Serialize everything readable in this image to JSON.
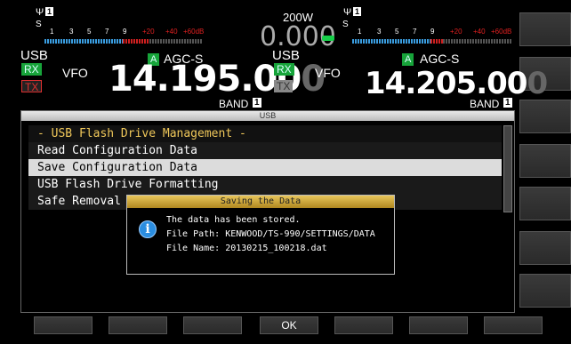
{
  "left_receiver": {
    "mode": "USB",
    "vfo": "VFO",
    "rx_label": "RX",
    "tx_label": "TX",
    "agc_badge": "A",
    "agc": "AGC-S",
    "frequency_main": "14.195.00",
    "frequency_dim": "0",
    "band_label": "BAND",
    "band_num": "1",
    "antenna_num": "1",
    "s_label": "S",
    "meter_ticks": [
      "1",
      "3",
      "5",
      "7",
      "9",
      "+20",
      "+40",
      "+60dB"
    ]
  },
  "center": {
    "power": "200W",
    "power_reading": "0.000"
  },
  "right_receiver": {
    "mode": "USB",
    "vfo": "VFO",
    "rx_label": "RX",
    "tx_label": "TX",
    "agc_badge": "A",
    "agc": "AGC-S",
    "frequency_main": "14.205.00",
    "frequency_dim": "0",
    "band_label": "BAND",
    "band_num": "1",
    "antenna_num": "1",
    "s_label": "S",
    "meter_ticks": [
      "1",
      "3",
      "5",
      "7",
      "9",
      "+20",
      "+40",
      "+60dB"
    ]
  },
  "usb_panel": {
    "title": "USB",
    "items": [
      "- USB Flash Drive Management -",
      "Read Configuration Data",
      "Save Configuration Data",
      "USB Flash Drive Formatting",
      "Safe Removal"
    ]
  },
  "dialog": {
    "title": "Saving the Data",
    "line1": "The data has been stored.",
    "line2": "File Path: KENWOOD/TS-990/SETTINGS/DATA",
    "line3": "File Name: 20130215_100218.dat"
  },
  "bottom_keys": [
    "",
    "",
    "",
    "OK",
    "",
    "",
    ""
  ],
  "colors": {
    "rx_green": "#17a43a",
    "tx_red": "#e03030",
    "header_yellow": "#f0c85a",
    "meter_blue": "#3a9de0",
    "meter_red": "#d02020"
  }
}
